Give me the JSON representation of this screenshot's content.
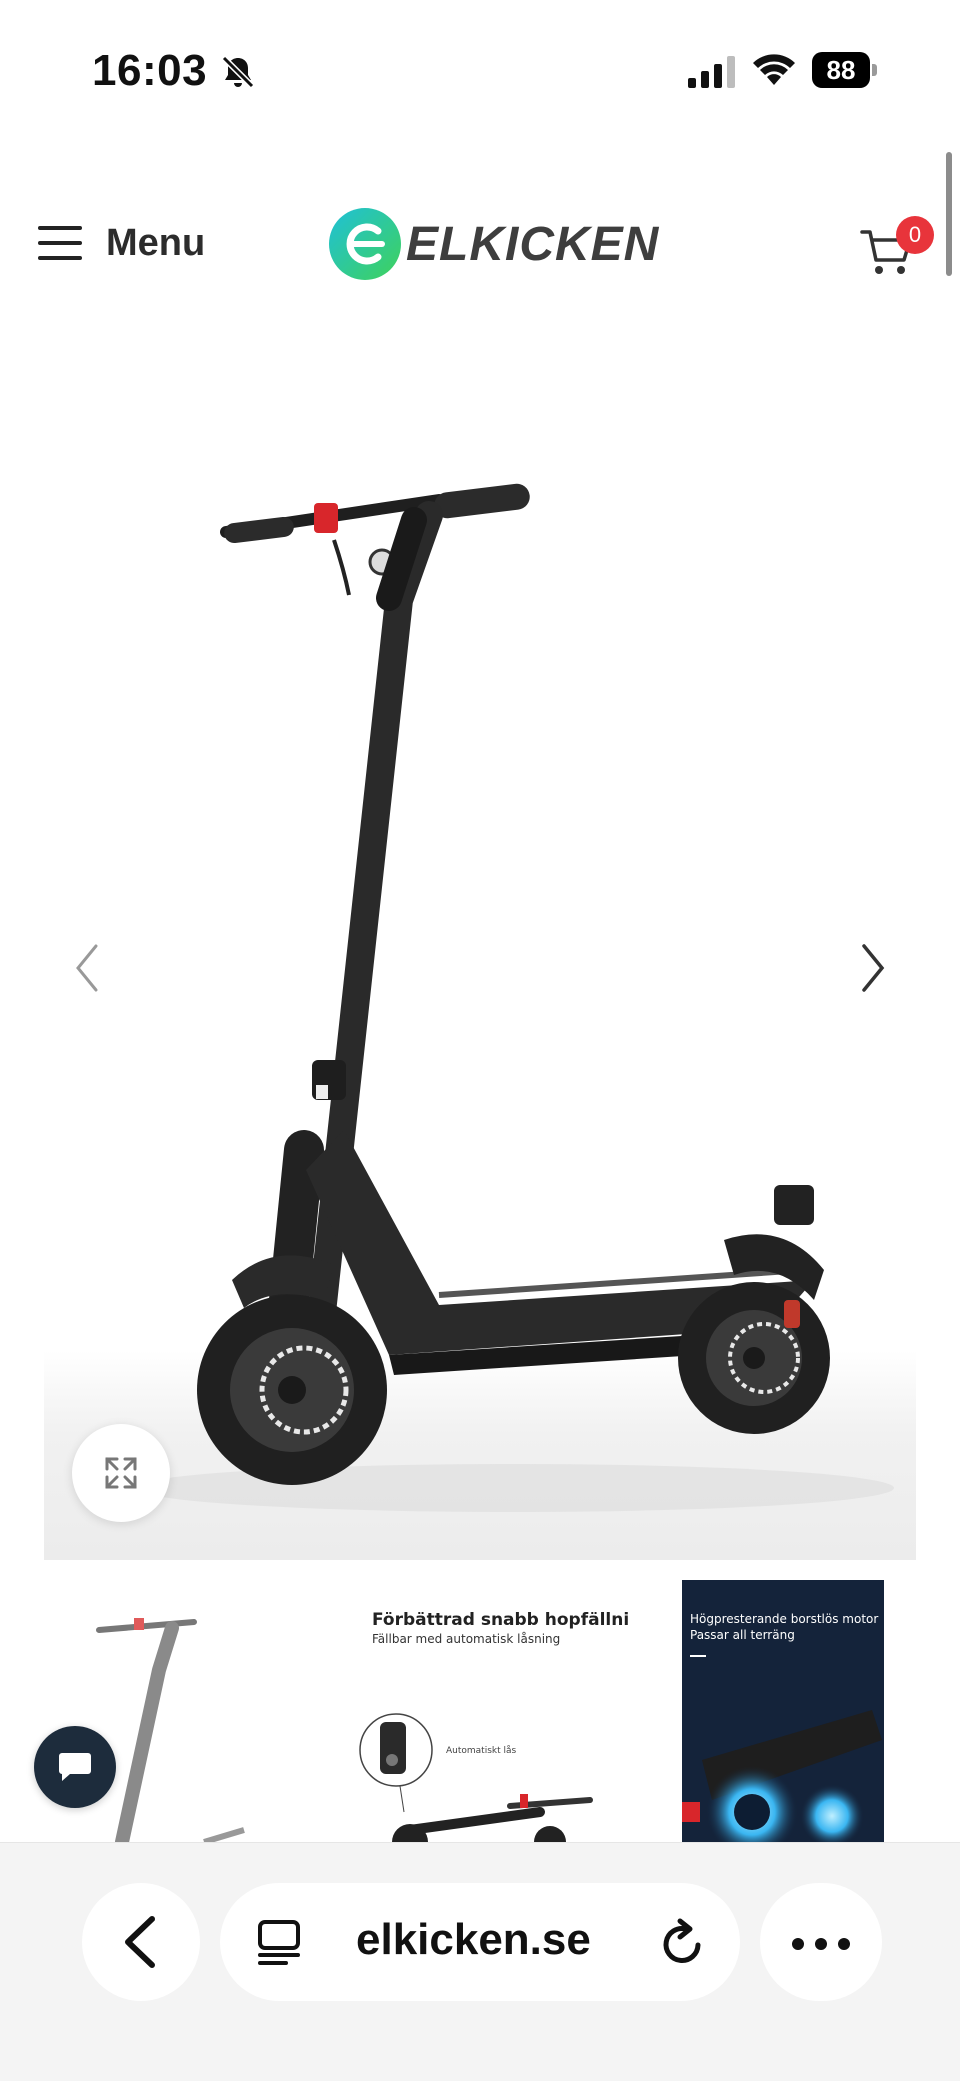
{
  "status_bar": {
    "time": "16:03",
    "battery": "88",
    "icons": [
      "bell-slash-icon",
      "cellular-signal-icon",
      "wifi-icon",
      "battery-icon"
    ]
  },
  "header": {
    "menu_label": "Menu",
    "logo_text": "ELKICKEN",
    "cart_count": "0",
    "colors": {
      "logo_gradient_start": "#1fc0d8",
      "logo_gradient_end": "#3fd25a",
      "badge": "#e8343b"
    }
  },
  "gallery": {
    "main_image": "electric-kick-scooter",
    "prev_icon": "chevron-left-icon",
    "next_icon": "chevron-right-icon",
    "expand_icon": "expand-arrows-icon"
  },
  "thumbnails": [
    {
      "image": "scooter-side-view"
    },
    {
      "image": "scooter-folding",
      "title": "Förbättrad snabb hopfällning",
      "subtitle": "Fällbar med automatisk låsning",
      "callout": "Automatiskt lås"
    },
    {
      "image": "scooter-motor",
      "title": "Högpresterande borstlös motor",
      "subtitle": "Passar all terräng"
    }
  ],
  "chat": {
    "icon": "chat-bubble-icon"
  },
  "browser_bar": {
    "url": "elkicken.se",
    "back_icon": "back-chevron-icon",
    "reader_icon": "reader-mode-icon",
    "reload_icon": "reload-icon",
    "more_icon": "more-dots-icon"
  }
}
